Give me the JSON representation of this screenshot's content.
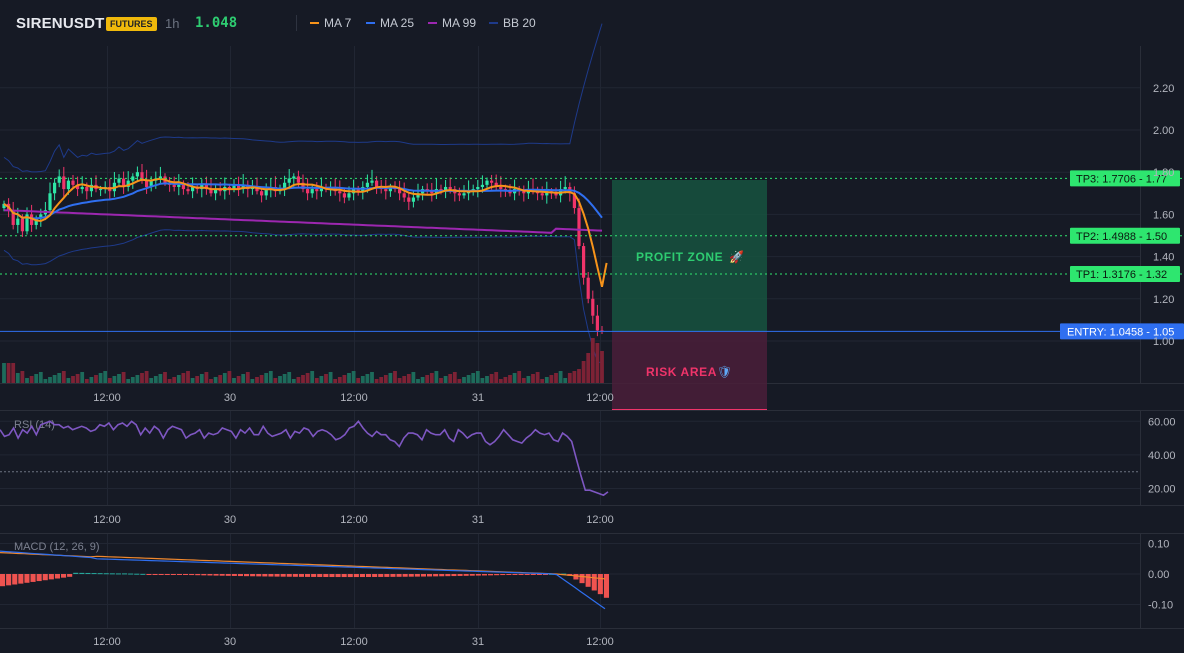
{
  "header": {
    "symbol": "SIRENUSDT",
    "badge": "FUTURES",
    "interval": "1h",
    "last_price": "1.048"
  },
  "legend": [
    {
      "label": "MA 7",
      "color": "#f7931a"
    },
    {
      "label": "MA 25",
      "color": "#2f6ff0"
    },
    {
      "label": "MA 99",
      "color": "#9c27b0"
    },
    {
      "label": "BB 20",
      "color": "#1e3a8a"
    }
  ],
  "price_axis": [
    "2.20",
    "2.00",
    "1.80",
    "1.60",
    "1.40",
    "1.20",
    "1.00"
  ],
  "time_axis": [
    "12:00",
    "30",
    "12:00",
    "31",
    "12:00"
  ],
  "levels": {
    "tp3": {
      "label": "TP3: 1.7706",
      "short": "1.77",
      "value": 1.7706
    },
    "tp2": {
      "label": "TP2: 1.4988",
      "short": "1.50",
      "value": 1.4988
    },
    "tp1": {
      "label": "TP1: 1.3176",
      "short": "1.32",
      "value": 1.3176
    },
    "entry": {
      "label": "ENTRY: 1.0458",
      "short": "1.05",
      "value": 1.0458
    }
  },
  "zones": {
    "profit": {
      "label": "PROFIT ZONE",
      "icon": "rocket-icon"
    },
    "risk": {
      "label": "RISK AREA",
      "icon": "shield-icon"
    }
  },
  "rsi": {
    "title": "RSI (14)",
    "axis": [
      "60.00",
      "40.00",
      "20.00"
    ],
    "level": 30,
    "values": [
      55,
      51,
      52,
      56,
      50,
      55,
      53,
      57,
      52,
      58,
      59,
      60,
      58,
      58,
      56,
      57,
      55,
      56,
      57,
      56,
      54,
      55,
      58,
      57,
      59,
      55,
      58,
      59,
      57,
      60,
      58,
      52,
      56,
      53,
      57,
      55,
      50,
      55,
      57,
      56,
      55,
      50,
      52,
      53,
      55,
      50,
      53,
      52,
      53,
      56,
      55,
      54,
      50,
      55,
      53,
      56,
      52,
      52,
      57,
      53,
      51,
      52,
      53,
      55,
      50,
      54,
      53,
      56,
      55,
      51,
      54,
      55,
      54,
      52,
      49,
      50,
      52,
      56,
      57,
      60,
      56,
      53,
      51,
      54,
      52,
      52,
      49,
      48,
      45,
      50,
      53,
      53,
      52,
      49,
      55,
      53,
      52,
      52,
      55,
      50,
      48,
      55,
      53,
      50,
      52,
      53,
      53,
      48,
      46,
      48,
      51,
      55,
      52,
      49,
      48,
      47,
      50,
      52,
      55,
      53,
      52,
      53,
      49,
      48,
      53,
      51,
      48,
      38,
      28,
      19,
      19,
      18,
      17,
      16,
      18
    ]
  },
  "macd": {
    "title": "MACD (12, 26, 9)",
    "axis": [
      "0.10",
      "0.00",
      "-0.10"
    ]
  },
  "chart_data": {
    "type": "candlestick",
    "series": [
      {
        "name": "MA 7",
        "color": "#f7931a"
      },
      {
        "name": "MA 25",
        "color": "#2f6ff0"
      },
      {
        "name": "MA 99",
        "color": "#9c27b0"
      },
      {
        "name": "BB 20",
        "color": "#1e3a8a"
      }
    ],
    "y_range": [
      0.8,
      2.3
    ],
    "close_values": [
      1.65,
      1.62,
      1.55,
      1.58,
      1.52,
      1.6,
      1.55,
      1.58,
      1.6,
      1.62,
      1.7,
      1.75,
      1.78,
      1.72,
      1.76,
      1.74,
      1.72,
      1.73,
      1.71,
      1.74,
      1.72,
      1.72,
      1.73,
      1.71,
      1.75,
      1.77,
      1.73,
      1.76,
      1.78,
      1.8,
      1.76,
      1.73,
      1.76,
      1.77,
      1.78,
      1.75,
      1.74,
      1.73,
      1.74,
      1.72,
      1.71,
      1.73,
      1.72,
      1.74,
      1.72,
      1.7,
      1.72,
      1.71,
      1.73,
      1.72,
      1.74,
      1.72,
      1.74,
      1.72,
      1.73,
      1.71,
      1.69,
      1.72,
      1.73,
      1.71,
      1.72,
      1.75,
      1.77,
      1.78,
      1.75,
      1.72,
      1.7,
      1.72,
      1.71,
      1.73,
      1.72,
      1.73,
      1.71,
      1.7,
      1.68,
      1.7,
      1.72,
      1.71,
      1.73,
      1.75,
      1.76,
      1.73,
      1.72,
      1.71,
      1.73,
      1.72,
      1.7,
      1.68,
      1.66,
      1.68,
      1.7,
      1.72,
      1.71,
      1.7,
      1.72,
      1.71,
      1.73,
      1.72,
      1.7,
      1.69,
      1.7,
      1.71,
      1.72,
      1.73,
      1.74,
      1.76,
      1.75,
      1.73,
      1.72,
      1.71,
      1.7,
      1.72,
      1.71,
      1.7,
      1.72,
      1.71,
      1.7,
      1.69,
      1.71,
      1.7,
      1.69,
      1.72,
      1.73,
      1.7,
      1.63,
      1.45,
      1.3,
      1.2,
      1.12,
      1.05,
      1.048
    ]
  }
}
